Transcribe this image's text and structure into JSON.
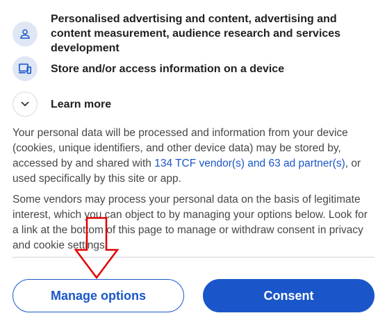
{
  "purposes": [
    {
      "icon": "person-icon",
      "label": "Personalised advertising and content, advertising and content measurement, audience research and services development"
    },
    {
      "icon": "devices-icon",
      "label": "Store and/or access information on a device"
    }
  ],
  "learn_more": {
    "icon": "chevron-down-icon",
    "label": "Learn more"
  },
  "paragraph1": {
    "before": "Your personal data will be processed and information from your device (cookies, unique identifiers, and other device data) may be stored by, accessed by and shared with ",
    "link": "134 TCF vendor(s) and 63 ad partner(s)",
    "after": ", or used specifically by this site or app."
  },
  "paragraph2": "Some vendors may process your personal data on the basis of legitimate interest, which you can object to by managing your options below. Look for a link at the bottom of this page to manage or withdraw consent in privacy and cookie settings.",
  "buttons": {
    "manage": "Manage options",
    "consent": "Consent"
  },
  "colors": {
    "accent": "#1a56c9",
    "icon_bg": "#dfe7f5",
    "annotation_arrow": "#e00000"
  }
}
